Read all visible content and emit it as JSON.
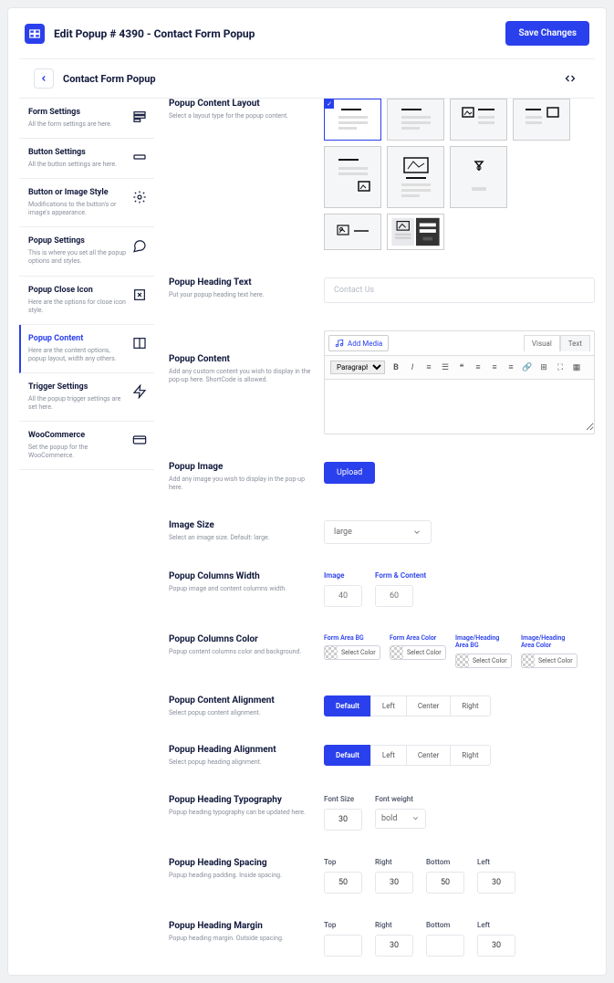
{
  "header": {
    "title": "Edit Popup # 4390 - Contact Form Popup",
    "saveBtn": "Save Changes"
  },
  "subbar": {
    "title": "Contact Form Popup"
  },
  "sidebar": [
    {
      "title": "Form Settings",
      "desc": "All the form settings are here.",
      "icon": "form"
    },
    {
      "title": "Button Settings",
      "desc": "All the button settings are here.",
      "icon": "button"
    },
    {
      "title": "Button or Image Style",
      "desc": "Modifications to the button's or image's appearance.",
      "icon": "gear"
    },
    {
      "title": "Popup Settings",
      "desc": "This is where you set all the popup options and styles.",
      "icon": "chat"
    },
    {
      "title": "Popup Close Icon",
      "desc": "Here are the options for close icon style.",
      "icon": "close"
    },
    {
      "title": "Popup Content",
      "desc": "Here are the content options, popup layout, width any others.",
      "icon": "layout",
      "active": true
    },
    {
      "title": "Trigger Settings",
      "desc": "All the popup trigger settings are set here.",
      "icon": "bolt"
    },
    {
      "title": "WooCommerce",
      "desc": "Set the popup for the WooCommerce.",
      "icon": "card"
    }
  ],
  "sections": {
    "layout": {
      "title": "Popup Content Layout",
      "desc": "Select a layout type for the popup content."
    },
    "headingText": {
      "title": "Popup Heading Text",
      "desc": "Put your popup heading text here.",
      "placeholder": "Contact Us"
    },
    "content": {
      "title": "Popup Content",
      "desc": "Add any custom content you wish to display in the pop-up here. ShortCode is allowed.",
      "addMedia": "Add Media",
      "tabVisual": "Visual",
      "tabText": "Text",
      "paragraph": "Paragraph"
    },
    "image": {
      "title": "Popup Image",
      "desc": "Add any image you wish to display in the pop-up here.",
      "uploadBtn": "Upload"
    },
    "imageSize": {
      "title": "Image Size",
      "desc": "Select an image size. Default: large.",
      "value": "large"
    },
    "columnsWidth": {
      "title": "Popup Columns Width",
      "desc": "Popup image and content columns width.",
      "imageLabel": "Image",
      "imageVal": "40",
      "formLabel": "Form & Content",
      "formVal": "60"
    },
    "columnsColor": {
      "title": "Popup Columns Color",
      "desc": "Popup content columns color and background.",
      "selectColor": "Select Color",
      "c1": "Form Area BG",
      "c2": "Form Area Color",
      "c3": "Image/Heading Area BG",
      "c4": "Image/Heading Area Color"
    },
    "contentAlign": {
      "title": "Popup Content Alignment",
      "desc": "Select popup content alignment."
    },
    "headingAlign": {
      "title": "Popup Heading Alignment",
      "desc": "Select popup heading alignment."
    },
    "alignOpts": [
      "Default",
      "Left",
      "Center",
      "Right"
    ],
    "typography": {
      "title": "Popup Heading Typography",
      "desc": "Popup heading typography can be updated here.",
      "fontSizeLabel": "Font Size",
      "fontSizeVal": "30",
      "fontWeightLabel": "Font weight",
      "fontWeightVal": "bold"
    },
    "spacing": {
      "title": "Popup Heading Spacing",
      "desc": "Popup heading padding. Inside spacing.",
      "top": "Top",
      "right": "Right",
      "bottom": "Bottom",
      "left": "Left",
      "tv": "50",
      "rv": "30",
      "bv": "50",
      "lv": "30"
    },
    "margin": {
      "title": "Popup Heading Margin",
      "desc": "Popup heading margin. Outside spacing.",
      "rv": "30",
      "lv": "30"
    }
  }
}
